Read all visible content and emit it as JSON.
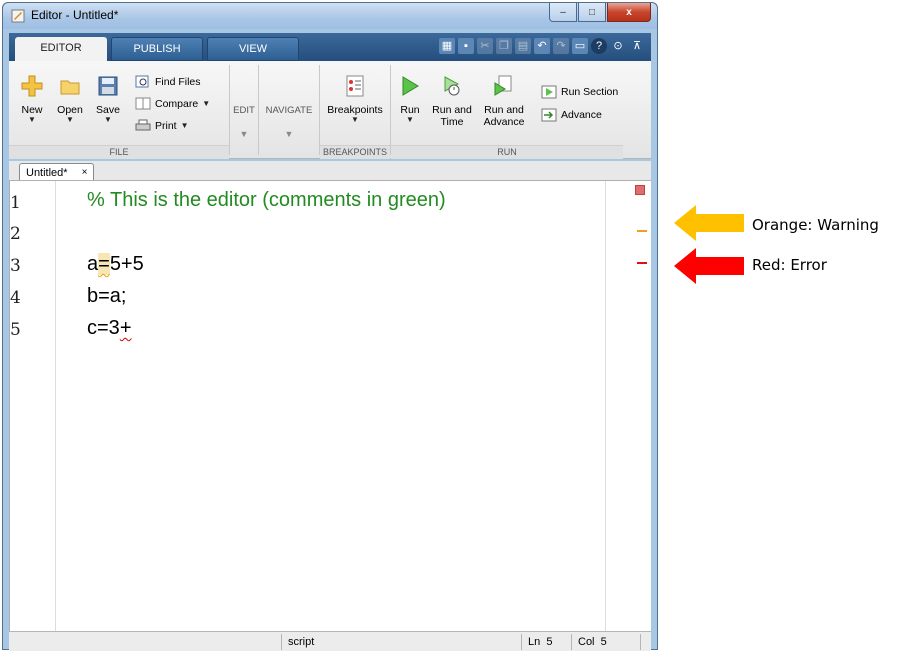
{
  "window": {
    "title": "Editor - Untitled*"
  },
  "window_buttons": {
    "minimize": "–",
    "maximize": "□",
    "close": "x"
  },
  "ribbon": {
    "tabs": [
      {
        "label": "EDITOR"
      },
      {
        "label": "PUBLISH"
      },
      {
        "label": "VIEW"
      }
    ]
  },
  "toolstrip": {
    "file": {
      "new_label": "New",
      "open_label": "Open",
      "save_label": "Save",
      "find_files_label": "Find Files",
      "compare_label": "Compare",
      "print_label": "Print",
      "group_label": "FILE"
    },
    "edit_label": "EDIT",
    "navigate_label": "NAVIGATE",
    "breakpoints": {
      "button_label": "Breakpoints",
      "group_label": "BREAKPOINTS"
    },
    "run": {
      "run_label": "Run",
      "run_and_time_label_1": "Run and",
      "run_and_time_label_2": "Time",
      "run_and_advance_label_1": "Run and",
      "run_and_advance_label_2": "Advance",
      "run_section_label": "Run Section",
      "advance_label": "Advance",
      "group_label": "RUN"
    }
  },
  "doc_tab": {
    "label": "Untitled*",
    "close": "×"
  },
  "editor": {
    "lines": [
      {
        "number": "1",
        "text": "% This is the editor (comments in green)"
      },
      {
        "number": "2",
        "text": ""
      },
      {
        "number": "3",
        "pre": "a",
        "warn": "=",
        "post": "5+5"
      },
      {
        "number": "4",
        "text": "b=a;"
      },
      {
        "number": "5",
        "pre": "c=3",
        "err": "+"
      }
    ]
  },
  "statusbar": {
    "mode": "script",
    "ln_label": "Ln",
    "ln_value": "5",
    "col_label": "Col",
    "col_value": "5"
  },
  "annotations": {
    "warning": {
      "text": "Orange: Warning",
      "color": "#ffc000"
    },
    "error": {
      "text": "Red: Error",
      "color": "#ff0000"
    }
  }
}
